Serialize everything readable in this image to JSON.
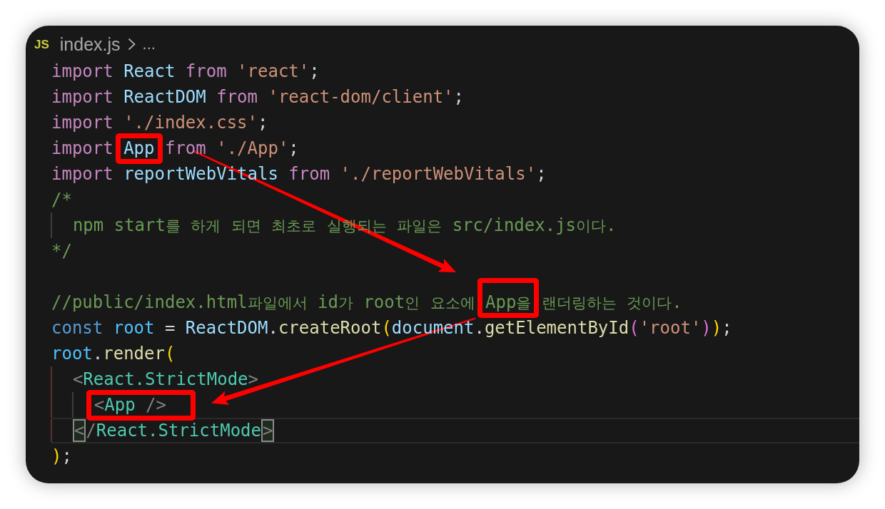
{
  "breadcrumb": {
    "file_badge": "JS",
    "file": "index.js",
    "more": "..."
  },
  "lines": [
    {
      "current": false,
      "tokens": [
        {
          "text": "import",
          "kind": "keyword"
        },
        {
          "text": " React",
          "kind": "variable"
        },
        {
          "text": " from",
          "kind": "keyword"
        },
        {
          "text": " 'react'",
          "kind": "string"
        },
        {
          "text": ";",
          "kind": "plain"
        }
      ]
    },
    {
      "current": false,
      "tokens": [
        {
          "text": "import",
          "kind": "keyword"
        },
        {
          "text": " ReactDOM",
          "kind": "variable"
        },
        {
          "text": " from",
          "kind": "keyword"
        },
        {
          "text": " 'react-dom/client'",
          "kind": "string"
        },
        {
          "text": ";",
          "kind": "plain"
        }
      ]
    },
    {
      "current": false,
      "tokens": [
        {
          "text": "import",
          "kind": "keyword"
        },
        {
          "text": " './index.css'",
          "kind": "string"
        },
        {
          "text": ";",
          "kind": "plain"
        }
      ]
    },
    {
      "current": false,
      "tokens": [
        {
          "text": "import ",
          "kind": "keyword"
        },
        {
          "text": "App",
          "kind": "variable",
          "boxed": true
        },
        {
          "text": " from",
          "kind": "keyword"
        },
        {
          "text": " './App'",
          "kind": "string"
        },
        {
          "text": ";",
          "kind": "plain"
        }
      ]
    },
    {
      "current": false,
      "tokens": [
        {
          "text": "import",
          "kind": "keyword"
        },
        {
          "text": " reportWebVitals",
          "kind": "variable"
        },
        {
          "text": " from",
          "kind": "keyword"
        },
        {
          "text": " './reportWebVitals'",
          "kind": "string"
        },
        {
          "text": ";",
          "kind": "plain"
        }
      ]
    },
    {
      "current": false,
      "tokens": [
        {
          "text": "/*",
          "kind": "comment"
        }
      ]
    },
    {
      "current": false,
      "active_guide": false,
      "tokens": [
        {
          "text": "  npm start를 하게 되면 최초로 실행되는 파일은 src/index.js이다.",
          "kind": "comment"
        }
      ]
    },
    {
      "current": false,
      "tokens": [
        {
          "text": "*/",
          "kind": "comment"
        }
      ]
    },
    {
      "current": false
    },
    {
      "current": false,
      "tokens": [
        {
          "text": "//public/index.html파일에서 id가 root인 요소에 ",
          "kind": "comment"
        },
        {
          "text": "App을",
          "kind": "comment",
          "boxed": true
        },
        {
          "text": " 랜더링하는 것이다.",
          "kind": "comment"
        }
      ]
    },
    {
      "current": false,
      "tokens": [
        {
          "text": "const",
          "kind": "storage"
        },
        {
          "text": " root",
          "kind": "constant"
        },
        {
          "text": " = ",
          "kind": "plain"
        },
        {
          "text": "ReactDOM",
          "kind": "variable"
        },
        {
          "text": ".",
          "kind": "plain"
        },
        {
          "text": "createRoot",
          "kind": "function"
        },
        {
          "text": "(",
          "kind": "bracket-1"
        },
        {
          "text": "document",
          "kind": "variable"
        },
        {
          "text": ".",
          "kind": "plain"
        },
        {
          "text": "getElementById",
          "kind": "function"
        },
        {
          "text": "(",
          "kind": "bracket-2"
        },
        {
          "text": "'root'",
          "kind": "string"
        },
        {
          "text": ")",
          "kind": "bracket-2"
        },
        {
          "text": ")",
          "kind": "bracket-1"
        },
        {
          "text": ";",
          "kind": "plain"
        }
      ]
    },
    {
      "current": false,
      "tokens": [
        {
          "text": "root",
          "kind": "constant"
        },
        {
          "text": ".",
          "kind": "plain"
        },
        {
          "text": "render",
          "kind": "function"
        },
        {
          "text": "(",
          "kind": "bracket-1"
        }
      ]
    },
    {
      "current": false,
      "active_guide": true,
      "tokens": [
        {
          "text": "  <",
          "kind": "tag-punct"
        },
        {
          "text": "React.StrictMode",
          "kind": "tag"
        },
        {
          "text": ">",
          "kind": "tag-punct"
        }
      ]
    },
    {
      "current": false,
      "active_guide": true,
      "tokens": [
        {
          "text": "    <",
          "kind": "tag-punct",
          "boxed": true
        },
        {
          "text": "App",
          "kind": "tag",
          "boxed": true
        },
        {
          "text": " />",
          "kind": "tag-punct",
          "boxed": true
        }
      ]
    },
    {
      "current": true,
      "active_guide": true,
      "tokens": [
        {
          "text": "  <",
          "kind": "tag-punct",
          "matched": true
        },
        {
          "text": "/",
          "kind": "tag-punct"
        },
        {
          "text": "React.StrictMode",
          "kind": "tag"
        },
        {
          "text": ">",
          "kind": "tag-punct",
          "matched": true
        }
      ]
    },
    {
      "current": false,
      "tokens": [
        {
          "text": ")",
          "kind": "bracket-1"
        },
        {
          "text": ";",
          "kind": "plain"
        }
      ]
    }
  ]
}
